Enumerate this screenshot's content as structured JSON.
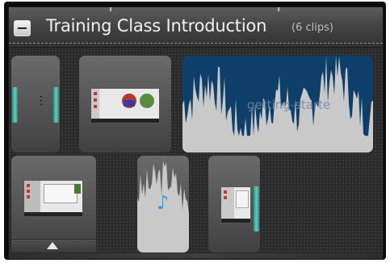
{
  "group": {
    "title": "Training Class  Introduction",
    "clip_count_label": "(6 clips)",
    "collapse_icon": "minus-icon"
  },
  "clips": [
    {
      "type": "video",
      "name": "clip-1"
    },
    {
      "type": "video",
      "name": "clip-2"
    },
    {
      "type": "audio",
      "name": "clip-3",
      "label": "getting-starte"
    },
    {
      "type": "video",
      "name": "clip-4"
    },
    {
      "type": "audio",
      "name": "clip-5",
      "icon": "music-note-icon"
    },
    {
      "type": "video",
      "name": "clip-6"
    }
  ],
  "expand_icon": "triangle-up-icon",
  "colors": {
    "audio_background": "#0e3f6a",
    "waveform": "#c9c9c9",
    "trim_handle": "#4ec3b5",
    "note": "#2e9df0"
  }
}
